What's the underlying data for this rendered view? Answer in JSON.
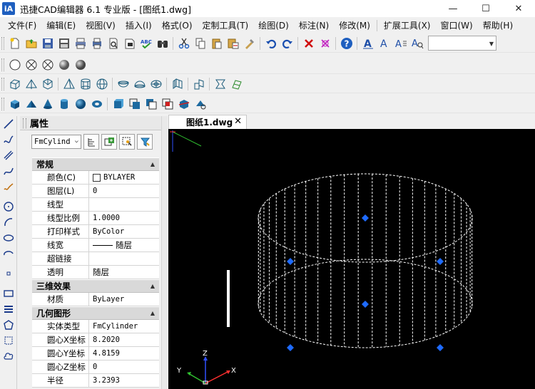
{
  "window": {
    "logo_text": "iA",
    "title": "迅捷CAD编辑器 6.1 专业版  - [图纸1.dwg]",
    "minimize": "—",
    "maximize": "☐",
    "close": "✕"
  },
  "menu": {
    "items": [
      {
        "label": "文件(F)"
      },
      {
        "label": "编辑(E)"
      },
      {
        "label": "视图(V)"
      },
      {
        "label": "插入(I)"
      },
      {
        "label": "格式(O)"
      },
      {
        "label": "定制工具(T)"
      },
      {
        "label": "绘图(D)"
      },
      {
        "label": "标注(N)"
      },
      {
        "label": "修改(M)"
      },
      {
        "label": "扩展工具(X)"
      },
      {
        "label": "窗口(W)"
      },
      {
        "label": "帮助(H)"
      }
    ]
  },
  "toolbar": {
    "text_style_combo_value": ""
  },
  "properties": {
    "title": "属性",
    "object_type_combo": "FmCylind",
    "sections": {
      "general": {
        "title": "常规",
        "rows": [
          {
            "key": "颜色(C)",
            "value": "BYLAYER"
          },
          {
            "key": "图层(L)",
            "value": "0"
          },
          {
            "key": "线型",
            "value": ""
          },
          {
            "key": "线型比例",
            "value": "1.0000"
          },
          {
            "key": "打印样式",
            "value": "ByColor"
          },
          {
            "key": "线宽",
            "value": "随层"
          },
          {
            "key": "超链接",
            "value": ""
          },
          {
            "key": "透明",
            "value": "随层"
          }
        ]
      },
      "effects3d": {
        "title": "三维效果",
        "rows": [
          {
            "key": "材质",
            "value": "ByLayer"
          }
        ]
      },
      "geometry": {
        "title": "几何图形",
        "rows": [
          {
            "key": "实体类型",
            "value": "FmCylinder"
          },
          {
            "key": "圆心X坐标",
            "value": "8.2020"
          },
          {
            "key": "圆心Y坐标",
            "value": "4.8159"
          },
          {
            "key": "圆心Z坐标",
            "value": "0"
          },
          {
            "key": "半径",
            "value": "3.2393"
          }
        ]
      }
    }
  },
  "drawing": {
    "tab_label": "图纸1.dwg",
    "tab_close": "✕",
    "ucs": {
      "x_label": "X",
      "y_label": "Y",
      "z_label": "Z"
    },
    "colors": {
      "background": "#000000",
      "wireframe": "#ffffff",
      "grip": "#1e6bff",
      "axis_x": "#ff3030",
      "axis_y": "#30c030",
      "axis_z": "#3050ff"
    }
  }
}
